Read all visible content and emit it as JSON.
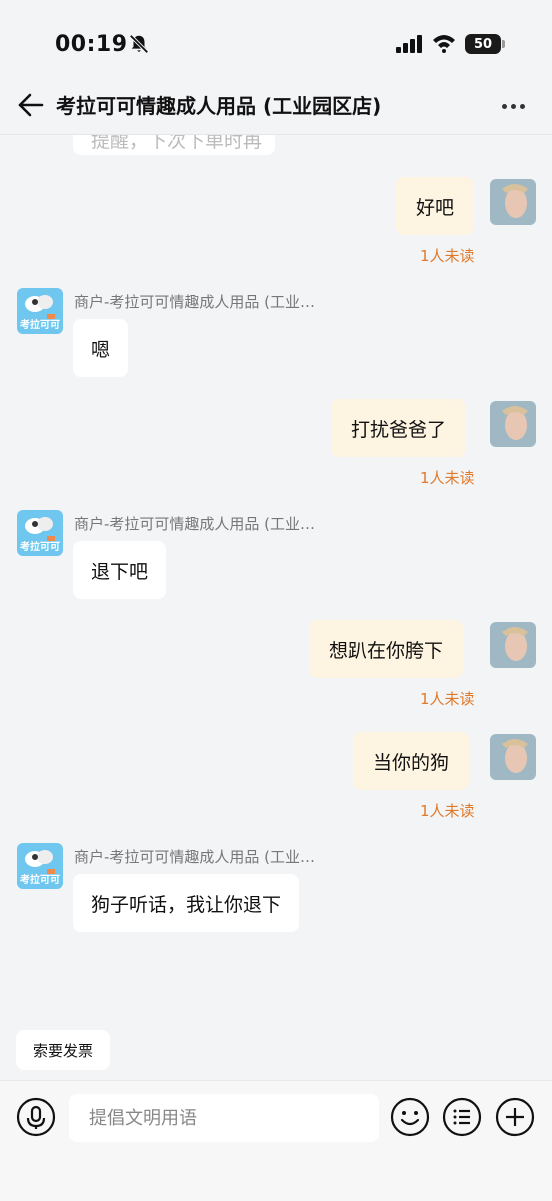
{
  "status_bar": {
    "time": "00:19",
    "battery": "50"
  },
  "header": {
    "title": "考拉可可情趣成人用品 (工业园区店)"
  },
  "messages": {
    "m0": {
      "text": "提醒，下次下单时再"
    },
    "m1": {
      "text": "好吧",
      "status": "1人未读"
    },
    "m2": {
      "sender": "商户-考拉可可情趣成人用品 (工业…",
      "text": "嗯"
    },
    "m3": {
      "text": "打扰爸爸了",
      "status": "1人未读"
    },
    "m4": {
      "sender": "商户-考拉可可情趣成人用品 (工业…",
      "text": "退下吧"
    },
    "m5": {
      "text": "想趴在你胯下",
      "status": "1人未读"
    },
    "m6": {
      "text": "当你的狗",
      "status": "1人未读"
    },
    "m7": {
      "sender": "商户-考拉可可情趣成人用品 (工业…",
      "text": "狗子听话，我让你退下"
    }
  },
  "shop_logo_text": "考拉可可",
  "quick_reply": {
    "label": "索要发票"
  },
  "input": {
    "placeholder": "提倡文明用语"
  },
  "colors": {
    "unread": "#e07a2c",
    "my_bubble": "#fdf4e1",
    "shop_bubble": "#ffffff",
    "background": "#f3f4f6",
    "shop_avatar": "#6fc6ee"
  }
}
